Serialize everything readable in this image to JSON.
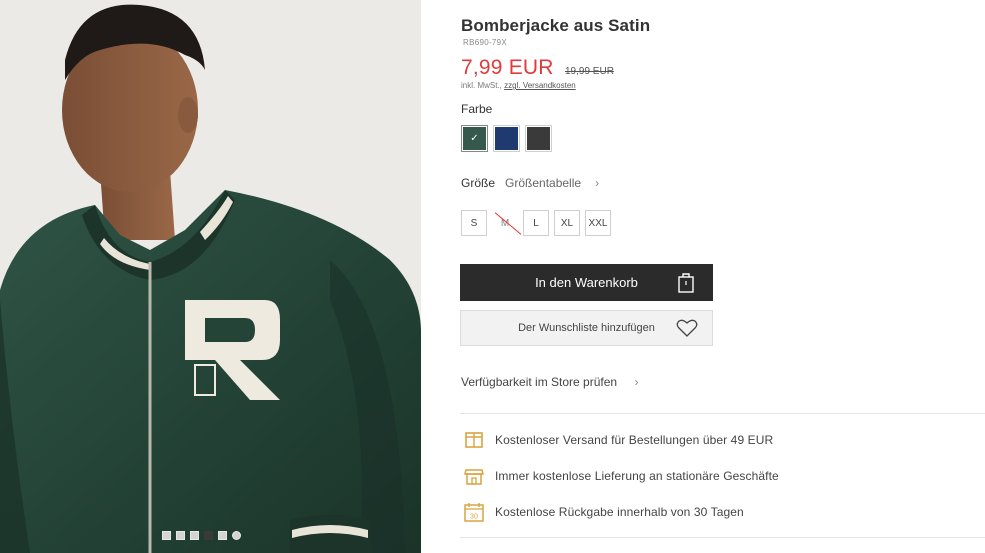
{
  "product": {
    "title": "Bomberjacke aus Satin",
    "sku": "RB690-79X",
    "price": "7,99 EUR",
    "old_price": "19,99 EUR",
    "tax_note": "inkl. MwSt.,",
    "shipping_link": "zzgl. Versandkosten"
  },
  "color": {
    "label": "Farbe",
    "swatches": [
      {
        "name": "green",
        "hex": "#35594c",
        "selected": true,
        "check": "✓"
      },
      {
        "name": "navy",
        "hex": "#1f3a6e",
        "selected": false
      },
      {
        "name": "black",
        "hex": "#3a3a3a",
        "selected": false
      }
    ]
  },
  "size": {
    "label": "Größe",
    "table_link": "Größentabelle",
    "chevron": "›",
    "options": [
      {
        "label": "S",
        "available": true
      },
      {
        "label": "M",
        "available": false
      },
      {
        "label": "L",
        "available": true
      },
      {
        "label": "XL",
        "available": true
      },
      {
        "label": "XXL",
        "available": true
      }
    ]
  },
  "actions": {
    "cart_label": "In den Warenkorb",
    "wishlist_label": "Der Wunschliste hinzufügen",
    "store_check": "Verfügbarkeit im Store prüfen"
  },
  "benefits": [
    {
      "icon": "truck-box-icon",
      "text": "Kostenloser Versand für Bestellungen über 49 EUR"
    },
    {
      "icon": "store-icon",
      "text": "Immer kostenlose Lieferung an stationäre Geschäfte"
    },
    {
      "icon": "calendar-30-icon",
      "text": "Kostenlose Rückgabe innerhalb von 30 Tagen"
    }
  ],
  "calendar_number": "30",
  "gallery": {
    "dots": 6,
    "active_dot": 3,
    "image_letter": "R"
  },
  "colors": {
    "accent": "#e23a3a",
    "button_dark": "#2b2b2b",
    "icon_gold": "#d9a441"
  }
}
